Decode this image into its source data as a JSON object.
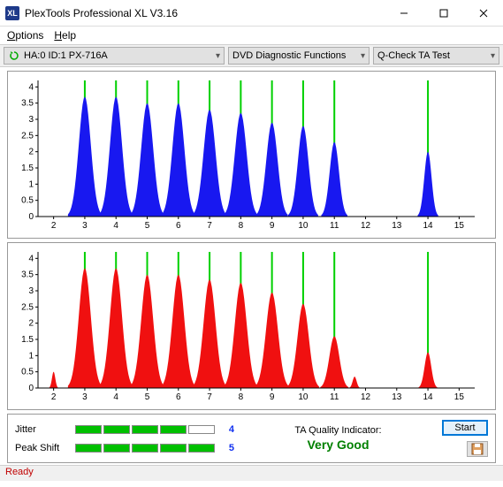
{
  "window": {
    "title": "PlexTools Professional XL V3.16",
    "icon_label": "XL"
  },
  "menu": {
    "options": "Options",
    "help": "Help"
  },
  "toolbar": {
    "device": "HA:0 ID:1  PX-716A",
    "category": "DVD Diagnostic Functions",
    "test": "Q-Check TA Test"
  },
  "stats": {
    "jitter_label": "Jitter",
    "jitter_segments": [
      true,
      true,
      true,
      true,
      false
    ],
    "jitter_value": "4",
    "peak_label": "Peak Shift",
    "peak_segments": [
      true,
      true,
      true,
      true,
      true
    ],
    "peak_value": "5",
    "ta_label": "TA Quality Indicator:",
    "ta_value": "Very Good"
  },
  "buttons": {
    "start": "Start"
  },
  "status": "Ready",
  "chart_data": [
    {
      "type": "area",
      "color": "#1818f0",
      "title": "",
      "xlabel": "",
      "ylabel": "",
      "xlim": [
        1.5,
        15.5
      ],
      "ylim": [
        0,
        4.2
      ],
      "xticks": [
        2,
        3,
        4,
        5,
        6,
        7,
        8,
        9,
        10,
        11,
        12,
        13,
        14,
        15
      ],
      "yticks": [
        0,
        0.5,
        1,
        1.5,
        2,
        2.5,
        3,
        3.5,
        4
      ],
      "gridlines_x": [
        3,
        4,
        5,
        6,
        7,
        8,
        9,
        10,
        11,
        14
      ],
      "peaks": [
        {
          "center": 3,
          "height": 3.7,
          "width": 0.9
        },
        {
          "center": 4,
          "height": 3.7,
          "width": 0.9
        },
        {
          "center": 5,
          "height": 3.5,
          "width": 0.9
        },
        {
          "center": 6,
          "height": 3.5,
          "width": 0.9
        },
        {
          "center": 7,
          "height": 3.3,
          "width": 0.9
        },
        {
          "center": 8,
          "height": 3.2,
          "width": 0.9
        },
        {
          "center": 9,
          "height": 2.9,
          "width": 0.85
        },
        {
          "center": 10,
          "height": 2.8,
          "width": 0.8
        },
        {
          "center": 11,
          "height": 2.3,
          "width": 0.7
        },
        {
          "center": 14,
          "height": 2.0,
          "width": 0.55
        }
      ]
    },
    {
      "type": "area",
      "color": "#f01010",
      "title": "",
      "xlabel": "",
      "ylabel": "",
      "xlim": [
        1.5,
        15.5
      ],
      "ylim": [
        0,
        4.2
      ],
      "xticks": [
        2,
        3,
        4,
        5,
        6,
        7,
        8,
        9,
        10,
        11,
        12,
        13,
        14,
        15
      ],
      "yticks": [
        0,
        0.5,
        1,
        1.5,
        2,
        2.5,
        3,
        3.5,
        4
      ],
      "gridlines_x": [
        3,
        4,
        5,
        6,
        7,
        8,
        9,
        10,
        11,
        14
      ],
      "peaks": [
        {
          "center": 2,
          "height": 0.5,
          "width": 0.25
        },
        {
          "center": 3,
          "height": 3.7,
          "width": 0.9
        },
        {
          "center": 4,
          "height": 3.7,
          "width": 0.9
        },
        {
          "center": 5,
          "height": 3.5,
          "width": 0.9
        },
        {
          "center": 6,
          "height": 3.5,
          "width": 0.9
        },
        {
          "center": 7,
          "height": 3.35,
          "width": 0.9
        },
        {
          "center": 8,
          "height": 3.25,
          "width": 0.9
        },
        {
          "center": 9,
          "height": 2.95,
          "width": 0.9
        },
        {
          "center": 10,
          "height": 2.6,
          "width": 0.85
        },
        {
          "center": 11,
          "height": 1.6,
          "width": 0.75
        },
        {
          "center": 11.65,
          "height": 0.35,
          "width": 0.3
        },
        {
          "center": 14,
          "height": 1.1,
          "width": 0.5
        }
      ]
    }
  ]
}
